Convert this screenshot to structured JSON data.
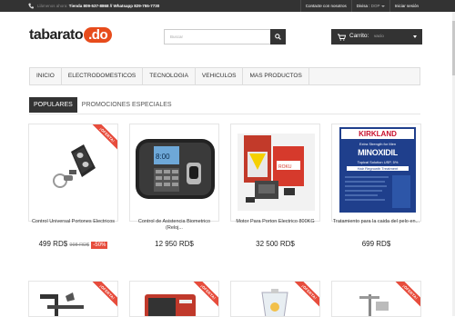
{
  "topbar": {
    "contact_prefix": "Llámenos ahora:",
    "contact_info": "Tienda 809-537-8868 // Whatsapp 829-755-7730",
    "contact_link": "Contacte con nosotros",
    "currency_label": "Divisa :",
    "currency_value": "DOP",
    "login": "Iniciar sesión"
  },
  "header": {
    "logo_text": "tabarato",
    "logo_suffix": ".do",
    "search_placeholder": "Buscar",
    "cart_label": "Carrito:",
    "cart_status": "vacío"
  },
  "nav": {
    "items": [
      "INICIO",
      "ELECTRODOMESTICOS",
      "TECNOLOGIA",
      "VEHICULOS",
      "MAS PRODUCTOS"
    ]
  },
  "tabs": [
    "POPULARES",
    "PROMOCIONES ESPECIALES"
  ],
  "ribbon_text": "¡OFERTA!",
  "products": [
    {
      "title": "Control Universal Portones Electricos",
      "price": "499 RD$",
      "old_price": "998 RD$",
      "discount": "-50%",
      "image": "remote-keyfob"
    },
    {
      "title": "Control de Asistencia Biometrico (Reloj...",
      "price": "12 950 RD$",
      "image": "biometric-clock"
    },
    {
      "title": "Motor Para Porton Electrico 800KG",
      "price": "32 500 RD$",
      "image": "gate-motor"
    },
    {
      "title": "Tratamiento para la caida del pelo en...",
      "price": "699 RD$",
      "image": "minoxidil-box",
      "box_text": {
        "brand": "KIRKLAND",
        "line1": "Extra Strength for Men",
        "name": "MINOXIDIL",
        "line2": "Topical Solution USP, 5%",
        "line3": "Hair Regrowth Treatment"
      }
    }
  ],
  "colors": {
    "accent": "#e74c3c",
    "dark": "#333333",
    "logo_orange": "#e74c1c"
  }
}
